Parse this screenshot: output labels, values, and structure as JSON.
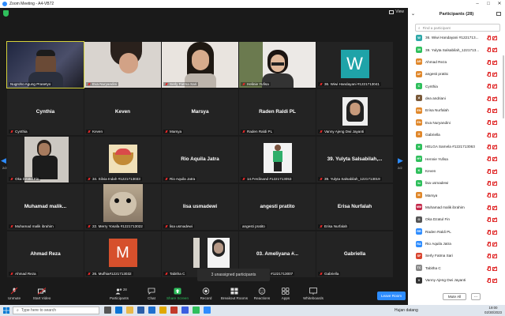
{
  "window": {
    "title": "Zoom Meeting - A4-VB72"
  },
  "meeting": {
    "view_label": "View",
    "page_left": "2/2",
    "page_right": "2/2",
    "toast": "3 unassigned participants"
  },
  "tiles": [
    {
      "name": "",
      "label": "Nugroho Agung Prasetyo",
      "type": "video",
      "active": true,
      "muted": false
    },
    {
      "name": "",
      "label": "Eva Nuryandini",
      "type": "video",
      "muted": true
    },
    {
      "name": "",
      "label": "Serly Fatma Sari",
      "type": "video",
      "muted": true
    },
    {
      "name": "",
      "label": "Helinie Yufisa",
      "type": "video",
      "muted": true
    },
    {
      "name": "",
      "label": "36. Wiwi Handayani #1221713041",
      "type": "w-avatar",
      "avatar_letter": "W",
      "muted": true
    },
    {
      "name": "Cynthia",
      "label": "Cynthia",
      "muted": true
    },
    {
      "name": "Keven",
      "label": "Keven",
      "muted": true
    },
    {
      "name": "Marsya",
      "label": "Marsya",
      "muted": true
    },
    {
      "name": "Raden Raldi PL",
      "label": "Raden Raldi PL",
      "muted": true
    },
    {
      "name": "",
      "label": "Vanny Ajeng Dwi Jayanti",
      "type": "photo",
      "muted": true
    },
    {
      "name": "",
      "label": "Oka Dzatul Fin",
      "type": "photo",
      "muted": true
    },
    {
      "name": "",
      "label": "34. Silvia Indah #1221713033",
      "type": "photo",
      "muted": true
    },
    {
      "name": "Rio Aquila Jatra",
      "label": "Rio Aquila Jatra",
      "muted": true
    },
    {
      "name": "",
      "label": "14.Ferdinand #1221713053",
      "type": "photo",
      "muted": true
    },
    {
      "name": "39. Yulyta Salsabilah,...",
      "label": "39. Yulyta Salsabilah_1221713019",
      "muted": true
    },
    {
      "name": "Muhamad  malik...",
      "label": "Muhamad malik ibrahim",
      "muted": true
    },
    {
      "name": "",
      "label": "22. Merry Yosafa #1221713022",
      "type": "photo",
      "muted": true
    },
    {
      "name": "lisa usmadewi",
      "label": "lisa usmadewi",
      "muted": true
    },
    {
      "name": "angesti pratito",
      "label": "angesti pratito",
      "muted": false
    },
    {
      "name": "Erisa Nurfalah",
      "label": "Erisa Nurfalah",
      "muted": true
    },
    {
      "name": "Ahmad Reza",
      "label": "Ahmad Reza",
      "muted": true
    },
    {
      "name": "",
      "label": "26. Mufhia#1221713032",
      "type": "m-avatar",
      "avatar_letter": "M",
      "muted": true
    },
    {
      "name": "",
      "label": "Tabitha C",
      "type": "photo",
      "muted": true
    },
    {
      "name": "03. Ameliyana #...",
      "label": "03. Ameliyana #1221713007",
      "muted": true
    },
    {
      "name": "Gabriella",
      "label": "Gabriella",
      "muted": true
    }
  ],
  "toolbar": {
    "unmute": "Unmute",
    "start_video": "Start Video",
    "participants": "Participants",
    "participants_count": "28",
    "chat": "Chat",
    "share": "Share Screen",
    "record": "Record",
    "breakout": "Breakout Rooms",
    "reactions": "Reactions",
    "apps": "Apps",
    "whiteboards": "Whiteboards",
    "leave": "Leave Room"
  },
  "panel": {
    "title": "Participants (28)",
    "search_placeholder": "Find a participant",
    "mute_all": "Mute All",
    "more": "...",
    "participants": [
      {
        "initials": "W",
        "color": "#2fa8a8",
        "name": "36. Wiwi Handayani #1221713...",
        "video_off": true
      },
      {
        "initials": "39",
        "color": "#2fbf5c",
        "name": "39. Yulyta Salsabilah_1221713...",
        "video_off": true
      },
      {
        "initials": "AR",
        "color": "#e0872a",
        "name": "Ahmad Reza",
        "video_off": true
      },
      {
        "initials": "AP",
        "color": "#e0872a",
        "name": "angesti pratito",
        "video_off": true
      },
      {
        "initials": "C",
        "color": "#2fbf5c",
        "name": "Cynthia",
        "video_off": true
      },
      {
        "initials": "d",
        "color": "#7a5a3a",
        "name": "dea andriani",
        "video_off": true
      },
      {
        "initials": "EN",
        "color": "#e0872a",
        "name": "Erisa Nurfalah",
        "video_off": true
      },
      {
        "initials": "EN",
        "color": "#e0872a",
        "name": "Eva Nuryandini",
        "video_off": true
      },
      {
        "initials": "G",
        "color": "#e0872a",
        "name": "Gabriella",
        "video_off": true
      },
      {
        "initials": "H",
        "color": "#2fbf5c",
        "name": "HELGA Samela #1221713063",
        "video_off": true
      },
      {
        "initials": "HY",
        "color": "#2fbf5c",
        "name": "Hennie Yufisa",
        "video_off": true
      },
      {
        "initials": "K",
        "color": "#2fbf5c",
        "name": "Keven",
        "video_off": true
      },
      {
        "initials": "lu",
        "color": "#2fbf5c",
        "name": "lisa usmadewi",
        "video_off": true
      },
      {
        "initials": "M",
        "color": "#e0872a",
        "name": "Marsya",
        "video_off": true
      },
      {
        "initials": "MM",
        "color": "#c4294a",
        "name": "Muhamad malik ibrahim",
        "video_off": true
      },
      {
        "initials": "O",
        "color": "#555555",
        "name": "Oka Dzatul Fin",
        "video_off": true
      },
      {
        "initials": "RR",
        "color": "#2d8cff",
        "name": "Raden Raldi PL",
        "video_off": true
      },
      {
        "initials": "RA",
        "color": "#2d8cff",
        "name": "Rio Aquila Jatra",
        "video_off": true
      },
      {
        "initials": "SF",
        "color": "#d9452f",
        "name": "Serly Fatma Sari",
        "video_off": true
      },
      {
        "initials": "TC",
        "color": "#888888",
        "name": "Tabitha C",
        "video_off": true
      },
      {
        "initials": "V",
        "color": "#333333",
        "name": "Vanny Ajeng Dwi Jayanti",
        "video_off": true
      }
    ]
  },
  "taskbar": {
    "search_placeholder": "Type here to search",
    "weather": "Hujan datang",
    "time": "19:00",
    "date": "02/30/2023"
  }
}
